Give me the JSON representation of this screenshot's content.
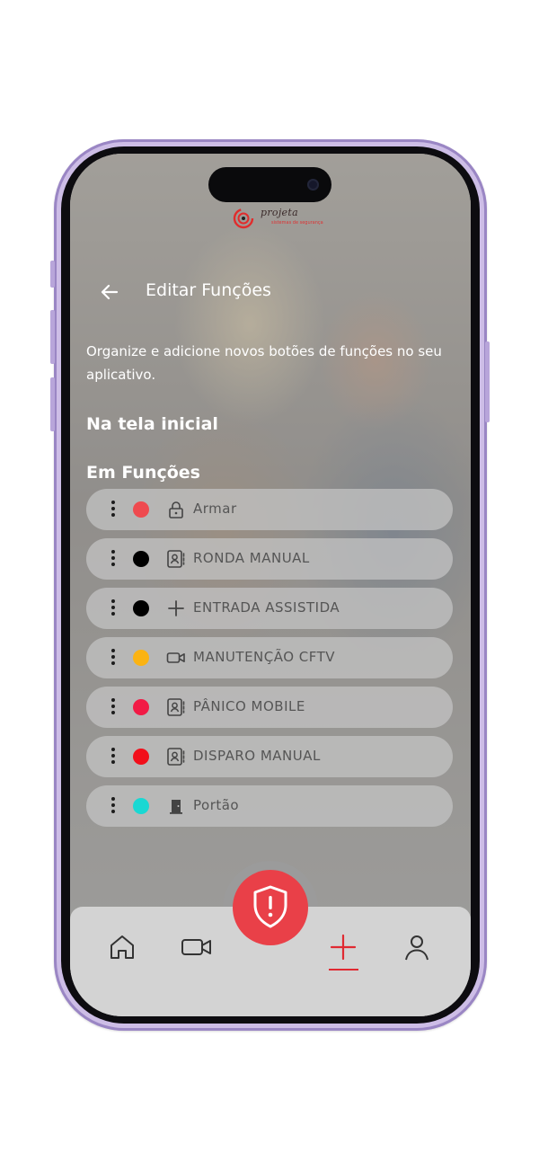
{
  "app": {
    "brand": "projeta",
    "brand_sub": "sistemas de segurança"
  },
  "header": {
    "back_icon": "arrow-left-icon",
    "title": "Editar Funções"
  },
  "description": "Organize e adicione novos botões de funções no seu aplicativo.",
  "sections": {
    "home": "Na tela inicial",
    "functions": "Em Funções"
  },
  "functions": [
    {
      "label": "Armar",
      "color": "#ef4a4f",
      "icon": "lock-icon"
    },
    {
      "label": "RONDA MANUAL",
      "color": "#000000",
      "icon": "contact-card-icon"
    },
    {
      "label": "ENTRADA ASSISTIDA",
      "color": "#000000",
      "icon": "plus-icon"
    },
    {
      "label": "MANUTENÇÃO CFTV",
      "color": "#fbb313",
      "icon": "video-camera-icon"
    },
    {
      "label": "PÂNICO MOBILE",
      "color": "#f21a45",
      "icon": "contact-card-icon"
    },
    {
      "label": "DISPARO MANUAL",
      "color": "#f20e1a",
      "icon": "contact-card-icon"
    },
    {
      "label": "Portão",
      "color": "#19d8d3",
      "icon": "door-icon"
    }
  ],
  "nav": {
    "items": [
      {
        "name": "home",
        "icon": "home-icon"
      },
      {
        "name": "cameras",
        "icon": "video-camera-icon"
      },
      {
        "name": "panic",
        "icon": "shield-alert-icon"
      },
      {
        "name": "add",
        "icon": "plus-icon",
        "active": true
      },
      {
        "name": "profile",
        "icon": "user-icon"
      }
    ],
    "accent": "#e02a32"
  }
}
